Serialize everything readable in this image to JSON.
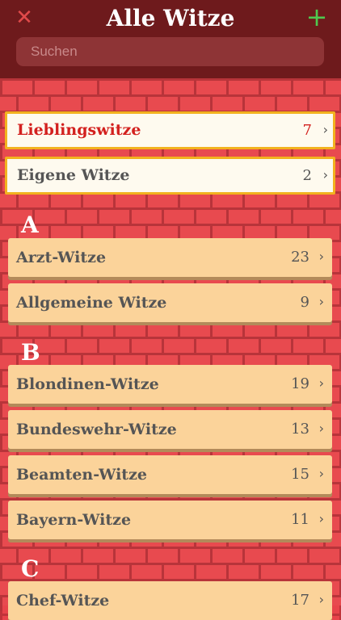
{
  "header": {
    "title": "Alle Witze",
    "close_icon": "close-icon",
    "add_icon": "plus-icon",
    "search_placeholder": "Suchen"
  },
  "special": [
    {
      "label": "Lieblingswitze",
      "count": "7"
    },
    {
      "label": "Eigene Witze",
      "count": "2"
    }
  ],
  "sections": [
    {
      "letter": "A",
      "items": [
        {
          "label": "Arzt-Witze",
          "count": "23"
        },
        {
          "label": "Allgemeine Witze",
          "count": "9"
        }
      ]
    },
    {
      "letter": "B",
      "items": [
        {
          "label": "Blondinen-Witze",
          "count": "19"
        },
        {
          "label": "Bundeswehr-Witze",
          "count": "13"
        },
        {
          "label": "Beamten-Witze",
          "count": "15"
        },
        {
          "label": "Bayern-Witze",
          "count": "11"
        }
      ]
    },
    {
      "letter": "C",
      "items": [
        {
          "label": "Chef-Witze",
          "count": "17"
        }
      ]
    }
  ],
  "chevron": "›",
  "colors": {
    "header_bg": "#6e1a1c",
    "brick": "#e84a4f",
    "mortar": "#b8343a",
    "row_bg": "#fbd39a",
    "special_border": "#f2b21f",
    "favorite_text": "#d3201e",
    "add_green": "#4fc94f"
  }
}
